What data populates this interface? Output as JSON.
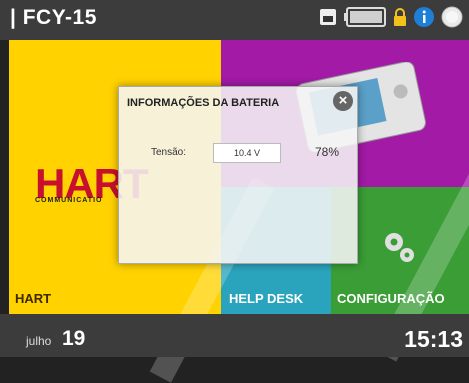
{
  "topbar": {
    "title": "| FCY-15"
  },
  "icons": [
    "sd-card-icon",
    "battery-icon",
    "lock-icon",
    "info-icon",
    "power-icon"
  ],
  "tiles": {
    "hart": {
      "label": "HART",
      "logo": "HART",
      "logo_sub": "COMMUNICATIO"
    },
    "helpdesk": {
      "label": "HELP DESK"
    },
    "config": {
      "label": "CONFIGURAÇÃO"
    }
  },
  "dialog": {
    "title": "INFORMAÇÕES DA BATERIA",
    "tension_label": "Tensão:",
    "tension_value": "10.4 V",
    "percent": "78%"
  },
  "bottombar": {
    "month": "julho",
    "day": "19",
    "time": "15:13"
  },
  "colors": {
    "hart": "#ffd200",
    "purple": "#a21aa6",
    "teal": "#2aa4bd",
    "green": "#3a9d36",
    "bar": "#3c3c3c"
  }
}
